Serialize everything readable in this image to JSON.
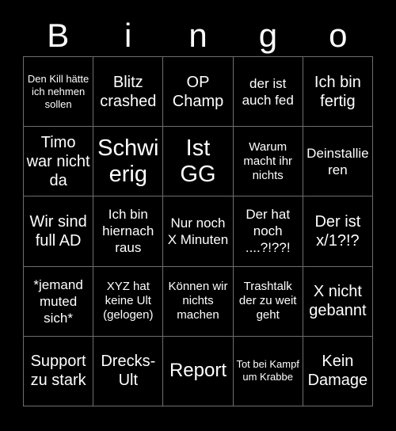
{
  "page": {
    "title": "Bingo",
    "background_color": "#000000",
    "text_color": "#ffffff",
    "grid_line_color": "#6e6e6e"
  },
  "header": {
    "letters": [
      {
        "label": "B"
      },
      {
        "label": "i"
      },
      {
        "label": "n"
      },
      {
        "label": "g"
      },
      {
        "label": "o"
      }
    ]
  },
  "grid": {
    "rows": 5,
    "columns": 5,
    "cells": [
      {
        "text": "Den Kill hätte ich nehmen sollen",
        "size": "fs-xs"
      },
      {
        "text": "Blitz crashed",
        "size": "fs-l"
      },
      {
        "text": "OP Champ",
        "size": "fs-l"
      },
      {
        "text": "der ist auch fed",
        "size": "fs-m"
      },
      {
        "text": "Ich bin fertig",
        "size": "fs-l"
      },
      {
        "text": "Timo war nicht da",
        "size": "fs-l"
      },
      {
        "text": "Schwierig",
        "size": "fs-xxl"
      },
      {
        "text": "Ist GG",
        "size": "fs-xxl"
      },
      {
        "text": "Warum macht ihr nichts",
        "size": "fs-s"
      },
      {
        "text": "Deinstallieren",
        "size": "fs-m"
      },
      {
        "text": "Wir sind full AD",
        "size": "fs-l"
      },
      {
        "text": "Ich bin hiernach raus",
        "size": "fs-m"
      },
      {
        "text": "Nur noch X Minuten",
        "size": "fs-m"
      },
      {
        "text": "Der hat noch ....?!??!",
        "size": "fs-m"
      },
      {
        "text": "Der ist x/1?!?",
        "size": "fs-l"
      },
      {
        "text": "*jemand muted sich*",
        "size": "fs-m"
      },
      {
        "text": "XYZ hat keine Ult (gelogen)",
        "size": "fs-s"
      },
      {
        "text": "Können wir nichts machen",
        "size": "fs-s"
      },
      {
        "text": "Trashtalk der zu weit geht",
        "size": "fs-s"
      },
      {
        "text": "X nicht gebannt",
        "size": "fs-l"
      },
      {
        "text": "Support zu stark",
        "size": "fs-l"
      },
      {
        "text": "Drecks-Ult",
        "size": "fs-l"
      },
      {
        "text": "Report",
        "size": "fs-xl"
      },
      {
        "text": "Tot bei Kampf um Krabbe",
        "size": "fs-xs"
      },
      {
        "text": "Kein Damage",
        "size": "fs-l"
      }
    ]
  }
}
